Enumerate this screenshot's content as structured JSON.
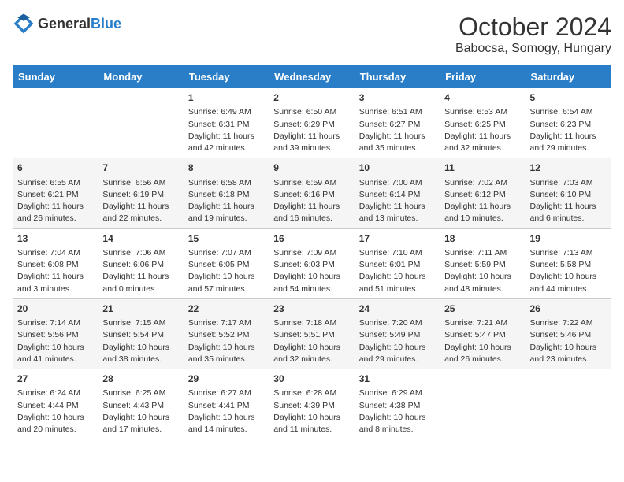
{
  "header": {
    "logo_general": "General",
    "logo_blue": "Blue",
    "month": "October 2024",
    "location": "Babocsa, Somogy, Hungary"
  },
  "days_of_week": [
    "Sunday",
    "Monday",
    "Tuesday",
    "Wednesday",
    "Thursday",
    "Friday",
    "Saturday"
  ],
  "weeks": [
    [
      {
        "day": "",
        "sunrise": "",
        "sunset": "",
        "daylight": ""
      },
      {
        "day": "",
        "sunrise": "",
        "sunset": "",
        "daylight": ""
      },
      {
        "day": "1",
        "sunrise": "Sunrise: 6:49 AM",
        "sunset": "Sunset: 6:31 PM",
        "daylight": "Daylight: 11 hours and 42 minutes."
      },
      {
        "day": "2",
        "sunrise": "Sunrise: 6:50 AM",
        "sunset": "Sunset: 6:29 PM",
        "daylight": "Daylight: 11 hours and 39 minutes."
      },
      {
        "day": "3",
        "sunrise": "Sunrise: 6:51 AM",
        "sunset": "Sunset: 6:27 PM",
        "daylight": "Daylight: 11 hours and 35 minutes."
      },
      {
        "day": "4",
        "sunrise": "Sunrise: 6:53 AM",
        "sunset": "Sunset: 6:25 PM",
        "daylight": "Daylight: 11 hours and 32 minutes."
      },
      {
        "day": "5",
        "sunrise": "Sunrise: 6:54 AM",
        "sunset": "Sunset: 6:23 PM",
        "daylight": "Daylight: 11 hours and 29 minutes."
      }
    ],
    [
      {
        "day": "6",
        "sunrise": "Sunrise: 6:55 AM",
        "sunset": "Sunset: 6:21 PM",
        "daylight": "Daylight: 11 hours and 26 minutes."
      },
      {
        "day": "7",
        "sunrise": "Sunrise: 6:56 AM",
        "sunset": "Sunset: 6:19 PM",
        "daylight": "Daylight: 11 hours and 22 minutes."
      },
      {
        "day": "8",
        "sunrise": "Sunrise: 6:58 AM",
        "sunset": "Sunset: 6:18 PM",
        "daylight": "Daylight: 11 hours and 19 minutes."
      },
      {
        "day": "9",
        "sunrise": "Sunrise: 6:59 AM",
        "sunset": "Sunset: 6:16 PM",
        "daylight": "Daylight: 11 hours and 16 minutes."
      },
      {
        "day": "10",
        "sunrise": "Sunrise: 7:00 AM",
        "sunset": "Sunset: 6:14 PM",
        "daylight": "Daylight: 11 hours and 13 minutes."
      },
      {
        "day": "11",
        "sunrise": "Sunrise: 7:02 AM",
        "sunset": "Sunset: 6:12 PM",
        "daylight": "Daylight: 11 hours and 10 minutes."
      },
      {
        "day": "12",
        "sunrise": "Sunrise: 7:03 AM",
        "sunset": "Sunset: 6:10 PM",
        "daylight": "Daylight: 11 hours and 6 minutes."
      }
    ],
    [
      {
        "day": "13",
        "sunrise": "Sunrise: 7:04 AM",
        "sunset": "Sunset: 6:08 PM",
        "daylight": "Daylight: 11 hours and 3 minutes."
      },
      {
        "day": "14",
        "sunrise": "Sunrise: 7:06 AM",
        "sunset": "Sunset: 6:06 PM",
        "daylight": "Daylight: 11 hours and 0 minutes."
      },
      {
        "day": "15",
        "sunrise": "Sunrise: 7:07 AM",
        "sunset": "Sunset: 6:05 PM",
        "daylight": "Daylight: 10 hours and 57 minutes."
      },
      {
        "day": "16",
        "sunrise": "Sunrise: 7:09 AM",
        "sunset": "Sunset: 6:03 PM",
        "daylight": "Daylight: 10 hours and 54 minutes."
      },
      {
        "day": "17",
        "sunrise": "Sunrise: 7:10 AM",
        "sunset": "Sunset: 6:01 PM",
        "daylight": "Daylight: 10 hours and 51 minutes."
      },
      {
        "day": "18",
        "sunrise": "Sunrise: 7:11 AM",
        "sunset": "Sunset: 5:59 PM",
        "daylight": "Daylight: 10 hours and 48 minutes."
      },
      {
        "day": "19",
        "sunrise": "Sunrise: 7:13 AM",
        "sunset": "Sunset: 5:58 PM",
        "daylight": "Daylight: 10 hours and 44 minutes."
      }
    ],
    [
      {
        "day": "20",
        "sunrise": "Sunrise: 7:14 AM",
        "sunset": "Sunset: 5:56 PM",
        "daylight": "Daylight: 10 hours and 41 minutes."
      },
      {
        "day": "21",
        "sunrise": "Sunrise: 7:15 AM",
        "sunset": "Sunset: 5:54 PM",
        "daylight": "Daylight: 10 hours and 38 minutes."
      },
      {
        "day": "22",
        "sunrise": "Sunrise: 7:17 AM",
        "sunset": "Sunset: 5:52 PM",
        "daylight": "Daylight: 10 hours and 35 minutes."
      },
      {
        "day": "23",
        "sunrise": "Sunrise: 7:18 AM",
        "sunset": "Sunset: 5:51 PM",
        "daylight": "Daylight: 10 hours and 32 minutes."
      },
      {
        "day": "24",
        "sunrise": "Sunrise: 7:20 AM",
        "sunset": "Sunset: 5:49 PM",
        "daylight": "Daylight: 10 hours and 29 minutes."
      },
      {
        "day": "25",
        "sunrise": "Sunrise: 7:21 AM",
        "sunset": "Sunset: 5:47 PM",
        "daylight": "Daylight: 10 hours and 26 minutes."
      },
      {
        "day": "26",
        "sunrise": "Sunrise: 7:22 AM",
        "sunset": "Sunset: 5:46 PM",
        "daylight": "Daylight: 10 hours and 23 minutes."
      }
    ],
    [
      {
        "day": "27",
        "sunrise": "Sunrise: 6:24 AM",
        "sunset": "Sunset: 4:44 PM",
        "daylight": "Daylight: 10 hours and 20 minutes."
      },
      {
        "day": "28",
        "sunrise": "Sunrise: 6:25 AM",
        "sunset": "Sunset: 4:43 PM",
        "daylight": "Daylight: 10 hours and 17 minutes."
      },
      {
        "day": "29",
        "sunrise": "Sunrise: 6:27 AM",
        "sunset": "Sunset: 4:41 PM",
        "daylight": "Daylight: 10 hours and 14 minutes."
      },
      {
        "day": "30",
        "sunrise": "Sunrise: 6:28 AM",
        "sunset": "Sunset: 4:39 PM",
        "daylight": "Daylight: 10 hours and 11 minutes."
      },
      {
        "day": "31",
        "sunrise": "Sunrise: 6:29 AM",
        "sunset": "Sunset: 4:38 PM",
        "daylight": "Daylight: 10 hours and 8 minutes."
      },
      {
        "day": "",
        "sunrise": "",
        "sunset": "",
        "daylight": ""
      },
      {
        "day": "",
        "sunrise": "",
        "sunset": "",
        "daylight": ""
      }
    ]
  ]
}
